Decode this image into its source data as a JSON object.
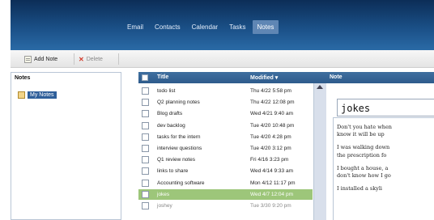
{
  "nav": {
    "items": [
      {
        "label": "Email"
      },
      {
        "label": "Contacts"
      },
      {
        "label": "Calendar"
      },
      {
        "label": "Tasks"
      },
      {
        "label": "Notes"
      }
    ],
    "active": "Notes"
  },
  "toolbar": {
    "add_label": "Add Note",
    "delete_label": "Delete"
  },
  "left_pane": {
    "heading": "Notes",
    "notebook": "My Notes"
  },
  "list": {
    "col_title": "Title",
    "col_modified": "Modified ▾",
    "rows": [
      {
        "title": "todo list",
        "modified": "Thu 4/22 5:58 pm"
      },
      {
        "title": "Q2 planning notes",
        "modified": "Thu 4/22 12:08 pm"
      },
      {
        "title": "Blog drafts",
        "modified": "Wed 4/21 9:40 am"
      },
      {
        "title": "dev backlog",
        "modified": "Tue 4/20 10:48 pm"
      },
      {
        "title": "tasks for the intern",
        "modified": "Tue 4/20 4:28 pm"
      },
      {
        "title": "interview questions",
        "modified": "Tue 4/20 3:12 pm"
      },
      {
        "title": "Q1 review notes",
        "modified": "Fri 4/16 3:23 pm"
      },
      {
        "title": "links to share",
        "modified": "Wed 4/14 9:33 am"
      },
      {
        "title": "Accounting software",
        "modified": "Mon 4/12 11:17 pm"
      },
      {
        "title": "jokes",
        "modified": "Wed 4/7 12:04 pm",
        "selected": true
      },
      {
        "title": "joshey",
        "modified": "Tue 3/30 9:20 pm",
        "dim": true
      }
    ]
  },
  "preview": {
    "heading": "Note",
    "title_value": "jokes",
    "body": [
      [
        "Don't you hate when",
        "know it will be up"
      ],
      [
        "I was walking down",
        "the prescription fo"
      ],
      [
        "I bought a house, a",
        "don't know how I go"
      ],
      [
        "I installed a skyli"
      ]
    ]
  },
  "colors": {
    "header_top": "#0c2d57",
    "header_bottom": "#2a6aa6",
    "selected_row": "#9dc67a",
    "active_nav": "#5f86b4",
    "column_header": "#3f6f9f"
  }
}
